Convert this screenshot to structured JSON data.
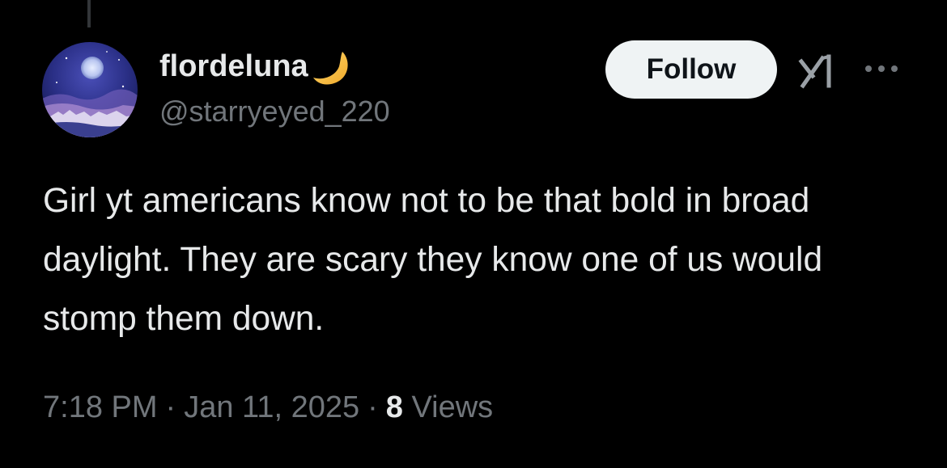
{
  "user": {
    "display_name": "flordeluna",
    "handle": "@starryeyed_220",
    "name_emoji": "crescent-moon-icon"
  },
  "actions": {
    "follow_label": "Follow",
    "grok_icon": "grok-icon",
    "more_icon": "more-icon"
  },
  "tweet": {
    "text": "Girl yt americans know not to be that bold in broad daylight. They are scary they know one of us would stomp them down."
  },
  "meta": {
    "time": "7:18 PM",
    "separator": "·",
    "date": "Jan 11, 2025",
    "views_count": "8",
    "views_label": "Views"
  },
  "colors": {
    "background": "#000000",
    "primary_text": "#e7e9ea",
    "secondary_text": "#71767b",
    "follow_bg": "#eff3f4",
    "follow_text": "#0f1419"
  }
}
